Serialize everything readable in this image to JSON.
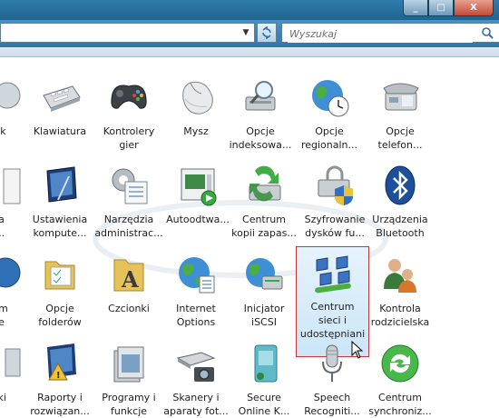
{
  "window": {
    "minimize": "_",
    "maximize": "□",
    "close": "X"
  },
  "navigation": {
    "search_placeholder": "Wyszukaj"
  },
  "items": [
    {
      "id": "partial-1",
      "label": "ęk"
    },
    {
      "id": "klawiatura",
      "label": "Klawiatura"
    },
    {
      "id": "kontrolery",
      "label": "Kontrolery\ngier"
    },
    {
      "id": "mysz",
      "label": "Mysz"
    },
    {
      "id": "opcje-indeks",
      "label": "Opcje\nindeksowa..."
    },
    {
      "id": "opcje-region",
      "label": "Opcje\nregionaln..."
    },
    {
      "id": "opcje-telefon",
      "label": "Opcje\ntelefon..."
    },
    {
      "id": "partial-2",
      "label": "ia\n..."
    },
    {
      "id": "ustawienia-komputer",
      "label": "Ustawienia\nkompute..."
    },
    {
      "id": "narzedzia-admin",
      "label": "Narzędzia\nadministrac..."
    },
    {
      "id": "autoodtwarzanie",
      "label": "Autoodtwa..."
    },
    {
      "id": "centrum-kopii",
      "label": "Centrum\nkopii zapas..."
    },
    {
      "id": "szyfrowanie",
      "label": "Szyfrowanie\ndysków fu..."
    },
    {
      "id": "bluetooth",
      "label": "Urządzenia\nBluetooth"
    },
    {
      "id": "partial-3",
      "label": "um\nie"
    },
    {
      "id": "opcje-folderow",
      "label": "Opcje\nfolderów"
    },
    {
      "id": "czcionki",
      "label": "Czcionki"
    },
    {
      "id": "internet-options",
      "label": "Internet\nOptions"
    },
    {
      "id": "inicjator-iscsi",
      "label": "Inicjator\niSCSI"
    },
    {
      "id": "centrum-sieci",
      "label": "Centrum\nsieci i\nudostępniani\na"
    },
    {
      "id": "kontrola-rodz",
      "label": "Kontrola\nrodzicielska"
    },
    {
      "id": "partial-4",
      "label": "rki"
    },
    {
      "id": "raporty",
      "label": "Raporty i\nrozwiązan..."
    },
    {
      "id": "programy",
      "label": "Programy i\nfunkcje"
    },
    {
      "id": "skanery",
      "label": "Skanery i\naparaty fot..."
    },
    {
      "id": "secure-online",
      "label": "Secure\nOnline K..."
    },
    {
      "id": "speech",
      "label": "Speech\nRecogniti..."
    },
    {
      "id": "centrum-synch",
      "label": "Centrum\nsynchroniz..."
    }
  ]
}
